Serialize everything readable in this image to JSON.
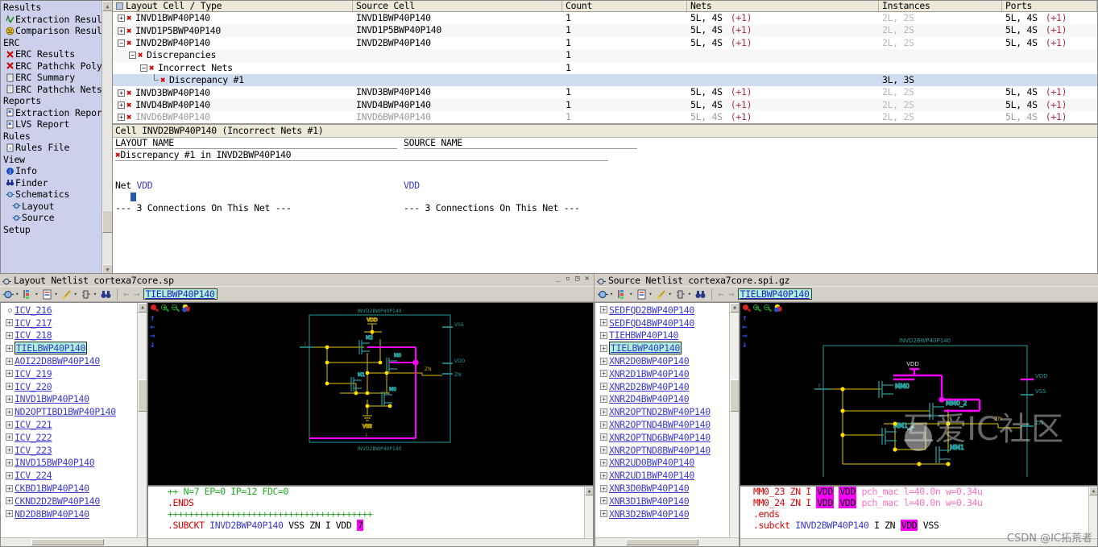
{
  "navigator": {
    "groups": [
      {
        "title": "Results",
        "items": [
          {
            "label": "Extraction Resul",
            "icon": "extraction-check-icon"
          },
          {
            "label": "Comparison Resul",
            "icon": "comparison-face-icon"
          }
        ]
      },
      {
        "title": "ERC",
        "items": [
          {
            "label": "ERC Results",
            "icon": "error-x-icon"
          },
          {
            "label": "ERC Pathchk Poly",
            "icon": "error-x-icon"
          },
          {
            "label": "ERC Summary",
            "icon": "document-icon"
          },
          {
            "label": "ERC Pathchk Nets",
            "icon": "document-icon"
          }
        ]
      },
      {
        "title": "Reports",
        "items": [
          {
            "label": "Extraction Repor",
            "icon": "report-icon"
          },
          {
            "label": "LVS Report",
            "icon": "report-icon"
          }
        ]
      },
      {
        "title": "Rules",
        "items": [
          {
            "label": "Rules File",
            "icon": "rules-file-icon"
          }
        ]
      },
      {
        "title": "View",
        "items": [
          {
            "label": "Info",
            "icon": "info-icon"
          },
          {
            "label": "Finder",
            "icon": "finder-binoculars-icon"
          },
          {
            "label": "Schematics",
            "icon": "schematic-icon"
          },
          {
            "label": "Layout",
            "icon": "schematic-icon",
            "sub": true
          },
          {
            "label": "Source",
            "icon": "schematic-icon",
            "sub": true
          }
        ]
      },
      {
        "title": "Setup",
        "items": []
      }
    ]
  },
  "results_table": {
    "columns": [
      "Layout Cell / Type",
      "Source Cell",
      "Count",
      "Nets",
      "Instances",
      "Ports"
    ],
    "rows": [
      {
        "depth": 0,
        "toggle": "plus",
        "x": true,
        "layout": "INVD1BWP40P140",
        "source": "INVD1BWP40P140",
        "count": "1",
        "nets": "5L, 4S",
        "nets_plus": "(+1)",
        "instances": "2L, 2S",
        "ports": "5L, 4S",
        "ports_plus": "(+1)"
      },
      {
        "depth": 0,
        "toggle": "plus",
        "x": true,
        "layout": "INVD1P5BWP40P140",
        "source": "INVD1P5BWP40P140",
        "count": "1",
        "nets": "5L, 4S",
        "nets_plus": "(+1)",
        "instances": "2L, 2S",
        "ports": "5L, 4S",
        "ports_plus": "(+1)"
      },
      {
        "depth": 0,
        "toggle": "minus",
        "x": true,
        "layout": "INVD2BWP40P140",
        "source": "INVD2BWP40P140",
        "count": "1",
        "nets": "5L, 4S",
        "nets_plus": "(+1)",
        "instances": "2L, 2S",
        "ports": "5L, 4S",
        "ports_plus": "(+1)"
      },
      {
        "depth": 1,
        "toggle": "minus",
        "x": true,
        "layout": "Discrepancies",
        "source": "",
        "count": "1",
        "nets": "",
        "nets_plus": "",
        "instances": "",
        "ports": "",
        "ports_plus": ""
      },
      {
        "depth": 2,
        "toggle": "minus",
        "x": true,
        "layout": "Incorrect Nets",
        "source": "",
        "count": "1",
        "nets": "",
        "nets_plus": "",
        "instances": "",
        "ports": "",
        "ports_plus": ""
      },
      {
        "depth": 3,
        "toggle": "elbow",
        "x": true,
        "layout": "Discrepancy #1",
        "source": "",
        "count": "",
        "nets": "",
        "nets_plus": "",
        "instances": "3L, 3S",
        "ports": "",
        "ports_plus": "",
        "selected": true
      },
      {
        "depth": 0,
        "toggle": "plus",
        "x": true,
        "layout": "INVD3BWP40P140",
        "source": "INVD3BWP40P140",
        "count": "1",
        "nets": "5L, 4S",
        "nets_plus": "(+1)",
        "instances": "2L, 2S",
        "ports": "5L, 4S",
        "ports_plus": "(+1)"
      },
      {
        "depth": 0,
        "toggle": "plus",
        "x": true,
        "layout": "INVD4BWP40P140",
        "source": "INVD4BWP40P140",
        "count": "1",
        "nets": "5L, 4S",
        "nets_plus": "(+1)",
        "instances": "2L, 2S",
        "ports": "5L, 4S",
        "ports_plus": "(+1)"
      },
      {
        "depth": 0,
        "toggle": "plus",
        "x": true,
        "layout": "INVD6BWP40P140",
        "source": "INVD6BWP40P140",
        "count": "1",
        "nets": "5L, 4S",
        "nets_plus": "(+1)",
        "instances": "2L, 2S",
        "ports": "5L, 4S",
        "ports_plus": "(+1)",
        "clipped": true
      }
    ]
  },
  "detail": {
    "title": "Cell INVD2BWP40P140 (Incorrect Nets #1)",
    "header_layout": "LAYOUT NAME",
    "header_source": "SOURCE NAME",
    "discrepancy_line": "Discrepancy #1 in INVD2BWP40P140",
    "net_label": "Net",
    "net_layout": "VDD",
    "net_source": "VDD",
    "connections_layout": "--- 3 Connections On This Net ---",
    "connections_source": "--- 3 Connections On This Net ---"
  },
  "layout_window": {
    "title": "Layout Netlist cortexa7core.sp",
    "window_buttons": [
      "minimize",
      "maximize",
      "restore",
      "close"
    ],
    "toolbar": {
      "buttons": [
        "schematic-icon",
        "hierarchy-icon",
        "properties-icon",
        "highlight-icon",
        "device-icon",
        "finder-binoculars-icon"
      ],
      "nav_back": "←",
      "nav_fwd": "→",
      "cell_field": "TIELBWP40P140"
    },
    "cell_tree": {
      "items": [
        {
          "label": "ICV_216",
          "toggle": "dot"
        },
        {
          "label": "ICV_217",
          "toggle": "plus"
        },
        {
          "label": "ICV_218",
          "toggle": "plus"
        },
        {
          "label": "TIELBWP40P140",
          "toggle": "plus",
          "selected": true
        },
        {
          "label": "AOI22D8BWP40P140",
          "toggle": "plus"
        },
        {
          "label": "ICV_219",
          "toggle": "plus"
        },
        {
          "label": "ICV_220",
          "toggle": "plus"
        },
        {
          "label": "INVD1BWP40P140",
          "toggle": "plus"
        },
        {
          "label": "ND2OPTIBD1BWP40P140",
          "toggle": "plus"
        },
        {
          "label": "ICV_221",
          "toggle": "plus"
        },
        {
          "label": "ICV_222",
          "toggle": "plus"
        },
        {
          "label": "ICV_223",
          "toggle": "plus"
        },
        {
          "label": "INVD15BWP40P140",
          "toggle": "plus"
        },
        {
          "label": "ICV_224",
          "toggle": "plus"
        },
        {
          "label": "CKBD1BWP40P140",
          "toggle": "plus"
        },
        {
          "label": "CKND2D2BWP40P140",
          "toggle": "plus"
        },
        {
          "label": "ND2D8BWP40P140",
          "toggle": "plus"
        }
      ]
    },
    "schematic": {
      "cell_label_top": "INVD2BWP40P140",
      "cell_label_bottom": "INVD2BWP40P140",
      "supply_top": "VDD",
      "supply_bottom": "VSS",
      "devices": [
        "M2",
        "M3",
        "M1",
        "M0"
      ],
      "pins_right": [
        "VSS",
        "VDD",
        "ZN"
      ],
      "pin_in": "I",
      "net_out": "ZN",
      "net_bottom": "I"
    },
    "netlist_text": {
      "lines": [
        {
          "segments": [
            {
              "t": "++ N=7 EP=0 IP=12 FDC=0",
              "c": "g"
            }
          ]
        },
        {
          "segments": [
            {
              "t": ".ENDS",
              "c": "r"
            }
          ]
        },
        {
          "segments": [
            {
              "t": "+++++++++++++++++++++++++++++++++++++++",
              "c": "g"
            }
          ]
        },
        {
          "segments": [
            {
              "t": ".SUBCKT ",
              "c": "r"
            },
            {
              "t": "INVD2BWP40P140",
              "c": "b"
            },
            {
              "t": " VSS ZN I VDD ",
              "c": ""
            },
            {
              "t": "7",
              "c": "mag"
            }
          ]
        }
      ]
    }
  },
  "source_window": {
    "title": "Source Netlist cortexa7core.spi.gz",
    "toolbar": {
      "buttons": [
        "schematic-icon",
        "hierarchy-icon",
        "properties-icon",
        "highlight-icon",
        "device-icon",
        "finder-binoculars-icon"
      ],
      "nav_back": "←",
      "nav_fwd": "→",
      "cell_field": "TIELBWP40P140"
    },
    "cell_tree": {
      "items": [
        {
          "label": "SEDFQD2BWP40P140",
          "toggle": "plus"
        },
        {
          "label": "SEDFQD4BWP40P140",
          "toggle": "plus"
        },
        {
          "label": "TIEHBWP40P140",
          "toggle": "plus"
        },
        {
          "label": "TIELBWP40P140",
          "toggle": "plus",
          "selected": true
        },
        {
          "label": "XNR2D0BWP40P140",
          "toggle": "plus"
        },
        {
          "label": "XNR2D1BWP40P140",
          "toggle": "plus"
        },
        {
          "label": "XNR2D2BWP40P140",
          "toggle": "plus"
        },
        {
          "label": "XNR2D4BWP40P140",
          "toggle": "plus"
        },
        {
          "label": "XNR2OPTND2BWP40P140",
          "toggle": "plus"
        },
        {
          "label": "XNR2OPTND4BWP40P140",
          "toggle": "plus"
        },
        {
          "label": "XNR2OPTND6BWP40P140",
          "toggle": "plus"
        },
        {
          "label": "XNR2OPTND8BWP40P140",
          "toggle": "plus"
        },
        {
          "label": "XNR2UD0BWP40P140",
          "toggle": "plus"
        },
        {
          "label": "XNR2UD1BWP40P140",
          "toggle": "plus"
        },
        {
          "label": "XNR3D0BWP40P140",
          "toggle": "plus"
        },
        {
          "label": "XNR3D1BWP40P140",
          "toggle": "plus"
        },
        {
          "label": "XNR3D2BWP40P140",
          "toggle": "plus"
        }
      ]
    },
    "schematic": {
      "cell_label_top": "INVD2BWP40P140",
      "supply_top": "VDD",
      "devices": [
        "MM0",
        "MM0_2",
        "MM1_2",
        "MM1"
      ],
      "pins_right": [
        "VDD",
        "VSS",
        "ZN"
      ],
      "pin_in": "I",
      "net_out": "ZN"
    },
    "netlist_text": {
      "lines": [
        {
          "segments": [
            {
              "t": "MM0_23 ZN I ",
              "c": "r"
            },
            {
              "t": "VDD",
              "c": "mag"
            },
            {
              "t": " ",
              "c": ""
            },
            {
              "t": "VDD",
              "c": "mag"
            },
            {
              "t": " pch_mac l=40.0n w=0.34u",
              "c": "pink"
            }
          ]
        },
        {
          "segments": [
            {
              "t": "MM0_24 ZN I ",
              "c": "r"
            },
            {
              "t": "VDD",
              "c": "mag"
            },
            {
              "t": " ",
              "c": ""
            },
            {
              "t": "VDD",
              "c": "mag"
            },
            {
              "t": " pch_mac l=40.0n w=0.34u",
              "c": "pink"
            }
          ]
        },
        {
          "segments": [
            {
              "t": ".ends",
              "c": "r"
            }
          ]
        },
        {
          "segments": [
            {
              "t": ".subckt ",
              "c": "r"
            },
            {
              "t": "INVD2BWP40P140",
              "c": "b"
            },
            {
              "t": " I ZN ",
              "c": ""
            },
            {
              "t": "VDD",
              "c": "mag"
            },
            {
              "t": " VSS",
              "c": ""
            }
          ]
        }
      ]
    }
  },
  "watermarks": {
    "csdn": "CSDN @IC拓荒者",
    "community": "互爱IC社区"
  },
  "colors": {
    "accent_error": "#cc0000",
    "plus_count": "#b03040",
    "net_blue": "#3a3ad0",
    "selection": "#d0dcf0",
    "field_green": "#aef0d8",
    "schematic_bg": "#000000",
    "wire_yellow": "#b8a000",
    "wire_magenta": "#ff00ff",
    "wire_cyan": "#2a9a9a"
  }
}
